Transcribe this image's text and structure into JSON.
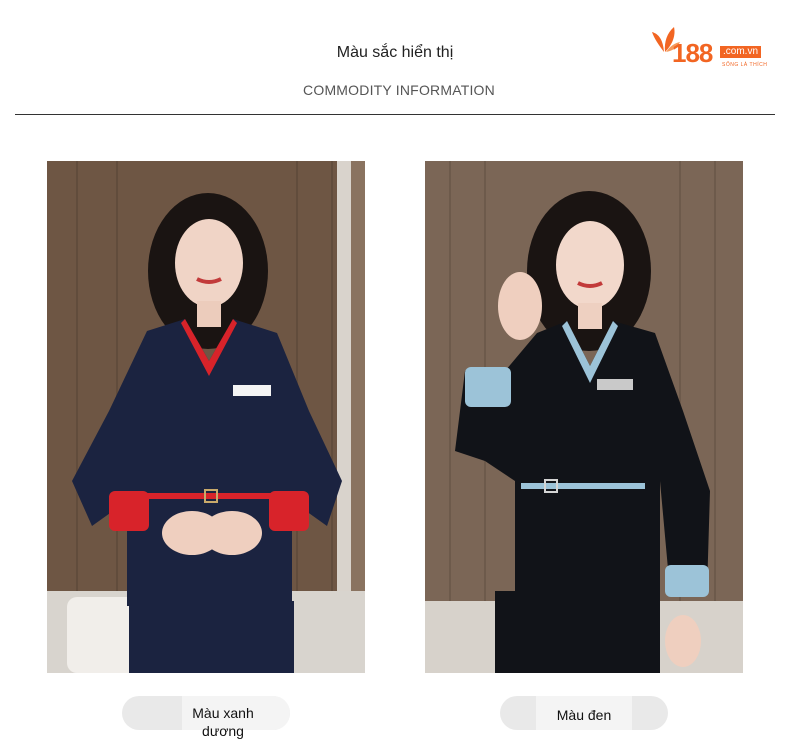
{
  "header": {
    "title": "Màu sắc hiển thị",
    "subtitle": "COMMODITY INFORMATION"
  },
  "logo": {
    "number": "188",
    "domain": ".com.vn",
    "tagline": "SỐNG LÀ THÍCH"
  },
  "products": [
    {
      "color_label": "Màu xanh dương",
      "jacket_color": "#1b2340",
      "accent_color": "#d8232a"
    },
    {
      "color_label": "Màu đen",
      "jacket_color": "#111318",
      "accent_color": "#9cc3d8"
    }
  ],
  "colors": {
    "brand": "#f26522",
    "background": "#ffffff"
  }
}
